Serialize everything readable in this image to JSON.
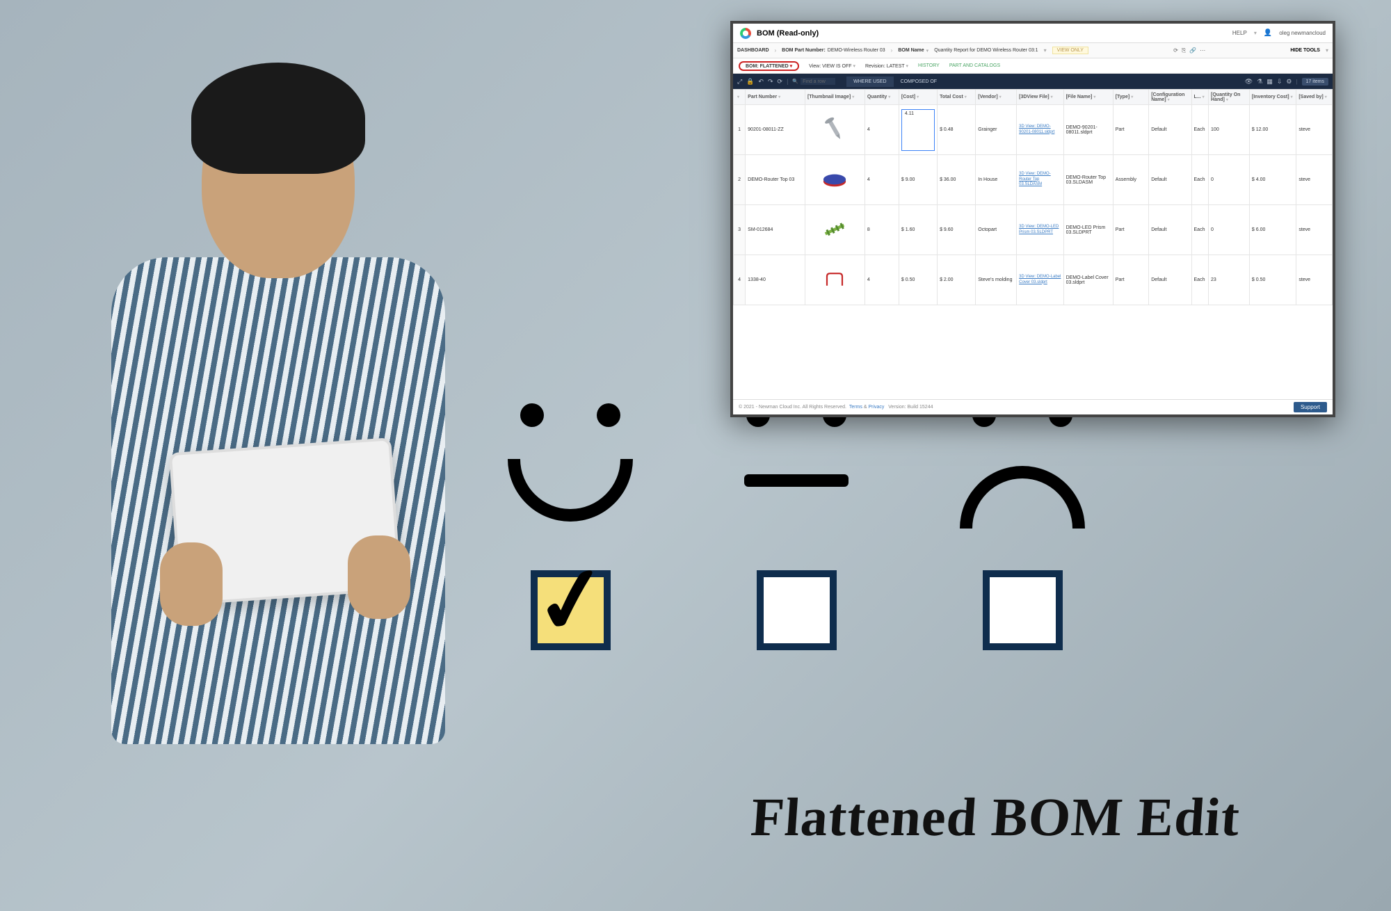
{
  "caption": "Flattened BOM Edit",
  "faces": {
    "checkbox_checked_index": 0
  },
  "app": {
    "title": "BOM (Read-only)",
    "help_label": "HELP",
    "user_name": "oleg newmancloud",
    "crumbs": {
      "dashboard": "DASHBOARD",
      "part_number_label": "BOM Part Number:",
      "part_number_value": "DEMO-Wireless Router 03",
      "bom_name_label": "BOM Name",
      "quantity_report": "Quantity Report for DEMO Wireless Router 03:1",
      "view_only": "VIEW ONLY",
      "hide_tools": "HIDE TOOLS"
    },
    "tabs": {
      "bom_label": "BOM: FLATTENED",
      "view_label": "View: VIEW IS OFF",
      "revision_label": "Revision: LATEST",
      "history": "HISTORY",
      "part_catalog": "PART AND CATALOGS"
    },
    "toolbar": {
      "search_placeholder": "Find a row",
      "where_used": "WHERE USED",
      "composed_of": "COMPOSED OF",
      "item_count": "17 items"
    },
    "columns": [
      "",
      "Part Number",
      "[Thumbnail Image]",
      "Quantity",
      "[Cost]",
      "Total Cost",
      "[Vendor]",
      "[3DView File]",
      "[File Name]",
      "[Type]",
      "[Configuration Name]",
      "L...",
      "[Quantity On Hand]",
      "[Inventory Cost]",
      "[Saved by]"
    ],
    "rows": [
      {
        "num": "1",
        "part_number": "90201-08011-ZZ",
        "thumb": "bolt",
        "quantity": "4",
        "cost_editing": true,
        "cost": "4.11",
        "total_cost": "$ 0.48",
        "vendor": "Grainger",
        "view3d": "3D View: DEMO-90201-08011.sldprt",
        "file_name": "DEMO-90201-08011.sldprt",
        "type": "Part",
        "config": "Default",
        "l": "Each",
        "qoh": "100",
        "inv_cost": "$ 12.00",
        "saved_by": "steve"
      },
      {
        "num": "2",
        "part_number": "DEMO-Router Top 03",
        "thumb": "top",
        "quantity": "4",
        "cost": "$ 9.00",
        "total_cost": "$ 36.00",
        "vendor": "In House",
        "view3d": "3D View: DEMO-Router Top 03.SLDASM",
        "file_name": "DEMO-Router Top 03.SLDASM",
        "type": "Assembly",
        "config": "Default",
        "l": "Each",
        "qoh": "0",
        "inv_cost": "$ 4.00",
        "saved_by": "steve"
      },
      {
        "num": "3",
        "part_number": "SM-012684",
        "thumb": "prism",
        "quantity": "8",
        "cost": "$ 1.60",
        "total_cost": "$ 9.60",
        "vendor": "Octopart",
        "view3d": "3D View: DEMO-LED Prism 03.SLDPRT",
        "file_name": "DEMO-LED Prism 03.SLDPRT",
        "type": "Part",
        "config": "Default",
        "l": "Each",
        "qoh": "0",
        "inv_cost": "$ 6.00",
        "saved_by": "steve"
      },
      {
        "num": "4",
        "part_number": "1338-40",
        "thumb": "cover",
        "quantity": "4",
        "cost": "$ 0.50",
        "total_cost": "$ 2.00",
        "vendor": "Steve's molding",
        "view3d": "3D View: DEMO-Label Cover 03.sldprt",
        "file_name": "DEMO-Label Cover 03.sldprt",
        "type": "Part",
        "config": "Default",
        "l": "Each",
        "qoh": "23",
        "inv_cost": "$ 0.50",
        "saved_by": "steve"
      }
    ],
    "footer": {
      "copyright": "© 2021 - Newman Cloud Inc. All Rights Reserved.",
      "terms": "Terms",
      "privacy": "Privacy",
      "version": "Version: Build 15244",
      "support": "Support"
    }
  }
}
